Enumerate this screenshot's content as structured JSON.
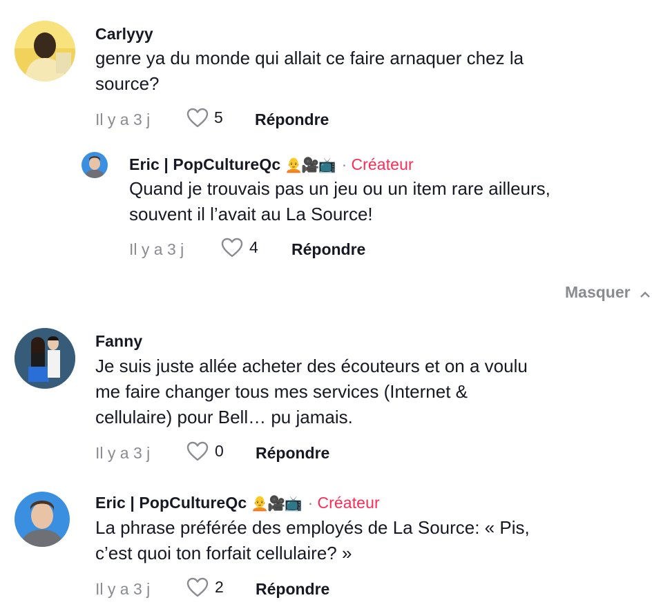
{
  "comments": [
    {
      "username": "Carlyyy",
      "text": "genre ya du monde qui allait ce faire arnaquer chez la\nsource?",
      "time": "Il y a 3 j",
      "likes": "5",
      "reply_label": "Répondre"
    },
    {
      "username": "Eric | PopCultureQc",
      "emoji": "🧑‍🦲🎥📺",
      "separator": "·",
      "badge": "Créateur",
      "text": "Quand je trouvais pas un jeu ou un item rare ailleurs,\nsouvent il l’avait au La Source!",
      "time": "Il y a 3 j",
      "likes": "4",
      "reply_label": "Répondre"
    },
    {
      "username": "Fanny",
      "text": "Je suis juste allée acheter des écouteurs et on a voulu\nme faire changer tous mes services (Internet &\ncellulaire) pour Bell… pu jamais.",
      "time": "Il y a 3 j",
      "likes": "0",
      "reply_label": "Répondre"
    },
    {
      "username": "Eric | PopCultureQc",
      "emoji": "🧑‍🦲🎥📺",
      "separator": "·",
      "badge": "Créateur",
      "text": "La phrase préférée des employés de La Source: « Pis,\nc’est quoi ton forfait cellulaire? »",
      "time": "Il y a 3 j",
      "likes": "2",
      "reply_label": "Répondre"
    }
  ],
  "hide_replies_label": "Masquer",
  "colors": {
    "creator_badge": "#fe2c55",
    "muted": "#8a8b91",
    "text": "#161823"
  }
}
